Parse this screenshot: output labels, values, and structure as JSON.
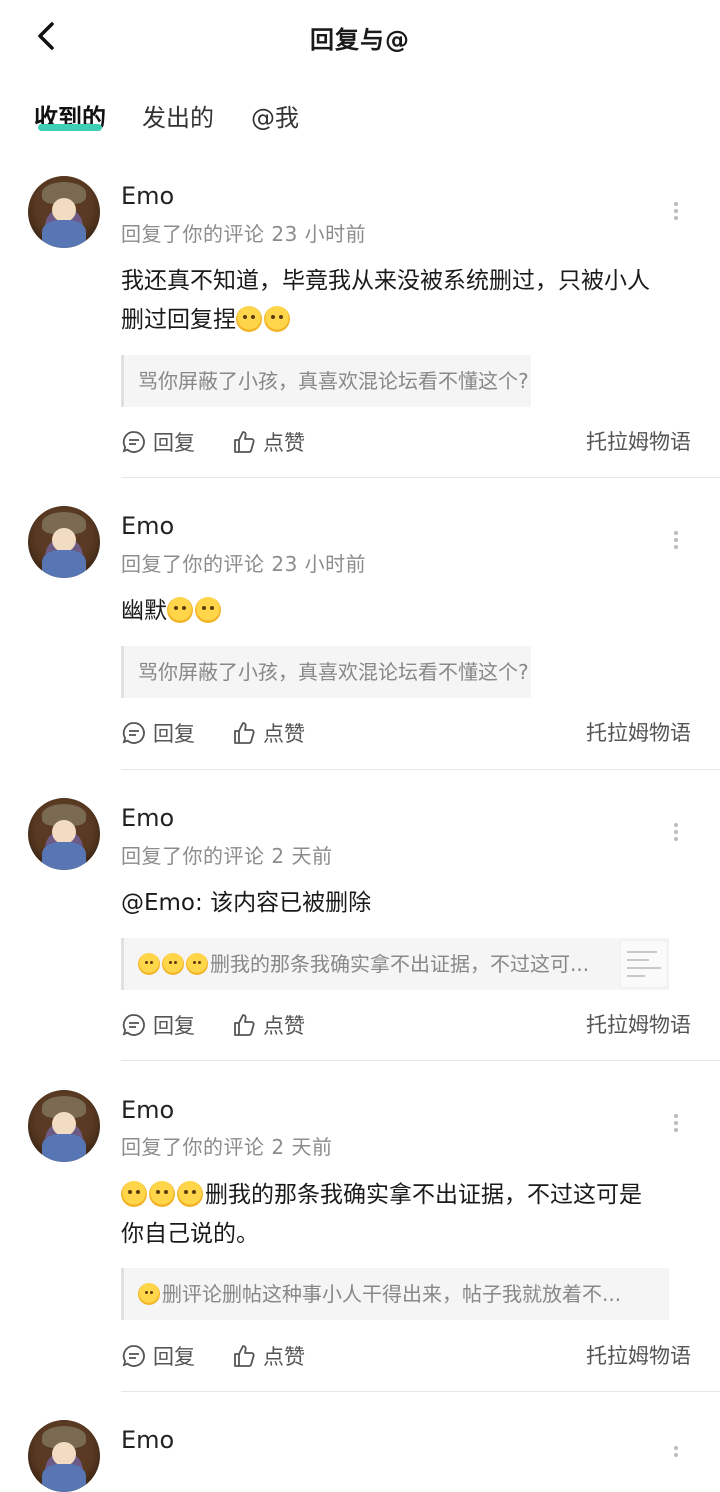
{
  "header": {
    "title": "回复与@"
  },
  "tabs": [
    {
      "label": "收到的",
      "active": true
    },
    {
      "label": "发出的",
      "active": false
    },
    {
      "label": "@我",
      "active": false
    }
  ],
  "colors": {
    "accent": "#3fcfb7"
  },
  "actions": {
    "reply": "回复",
    "like": "点赞",
    "source": "托拉姆物语"
  },
  "items": [
    {
      "username": "Emo",
      "meta": "回复了你的评论 23 小时前",
      "content_line1": "我还真不知道，毕竟我从来没被系统删过，只被小人",
      "content_line2": "删过回复捏",
      "content_emojis": 2,
      "quote": "骂你屏蔽了小孩，真喜欢混论坛看不懂这个?"
    },
    {
      "username": "Emo",
      "meta": "回复了你的评论 23 小时前",
      "content_line1": "幽默",
      "content_emojis": 2,
      "quote": "骂你屏蔽了小孩，真喜欢混论坛看不懂这个?"
    },
    {
      "username": "Emo",
      "meta": "回复了你的评论 2 天前",
      "content_line1": "@Emo: 该内容已被删除",
      "quote_emojis": 3,
      "quote": "删我的那条我确实拿不出证据，不过这可...",
      "has_thumbnail": true
    },
    {
      "username": "Emo",
      "meta": "回复了你的评论 2 天前",
      "content_emojis": 3,
      "content_line1": "删我的那条我确实拿不出证据，不过这可是",
      "content_line2": "你自己说的。",
      "quote_emojis": 1,
      "quote": "删评论删帖这种事小人干得出来，帖子我就放着不..."
    },
    {
      "username": "Emo"
    }
  ]
}
